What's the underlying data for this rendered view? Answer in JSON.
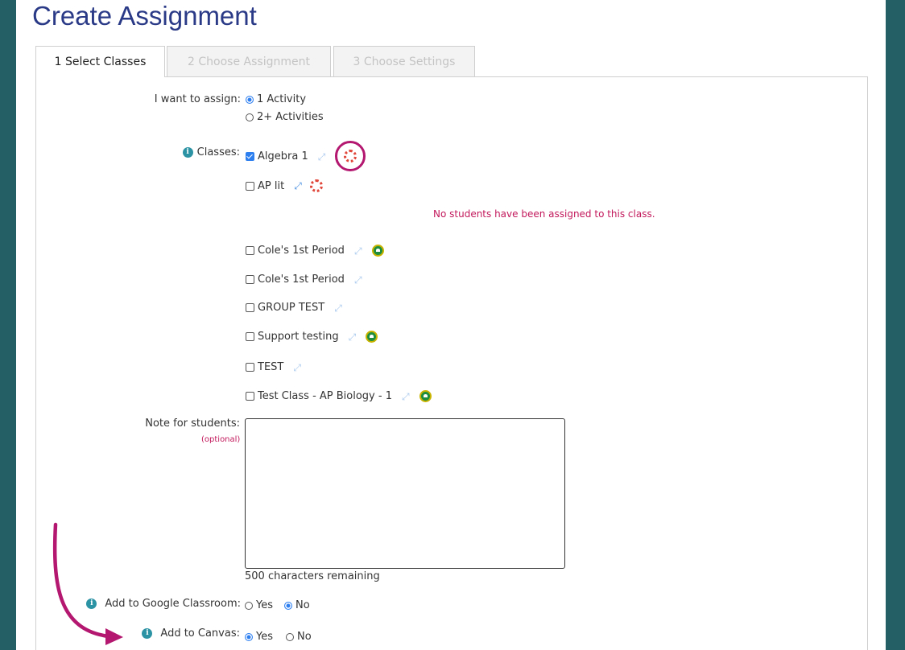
{
  "page": {
    "title": "Create Assignment"
  },
  "tabs": [
    {
      "label": "1 Select Classes",
      "active": true
    },
    {
      "label": "2 Choose Assignment",
      "active": false
    },
    {
      "label": "3 Choose Settings",
      "active": false
    }
  ],
  "assign": {
    "label": "I want to assign:",
    "options": [
      {
        "label": "1 Activity",
        "selected": true
      },
      {
        "label": "2+ Activities",
        "selected": false
      }
    ]
  },
  "classes": {
    "label": "Classes:",
    "warning": "No students have been assigned to this class.",
    "items": [
      {
        "name": "Algebra 1",
        "checked": true,
        "canvas": true,
        "google_classroom": false
      },
      {
        "name": "AP lit",
        "checked": false,
        "canvas": true,
        "google_classroom": false
      },
      {
        "name": "Cole's 1st Period",
        "checked": false,
        "canvas": false,
        "google_classroom": true
      },
      {
        "name": "Cole's 1st Period",
        "checked": false,
        "canvas": false,
        "google_classroom": false
      },
      {
        "name": "GROUP TEST",
        "checked": false,
        "canvas": false,
        "google_classroom": false
      },
      {
        "name": "Support testing",
        "checked": false,
        "canvas": false,
        "google_classroom": true
      },
      {
        "name": "TEST",
        "checked": false,
        "canvas": false,
        "google_classroom": false
      },
      {
        "name": "Test Class - AP Biology - 1",
        "checked": false,
        "canvas": false,
        "google_classroom": true
      }
    ]
  },
  "note": {
    "label": "Note for students:",
    "optional": "(optional)",
    "value": "",
    "counter": "500 characters remaining"
  },
  "google_classroom": {
    "label": "Add to Google Classroom:",
    "yes": "Yes",
    "no": "No",
    "selected": "No"
  },
  "canvas": {
    "label": "Add to Canvas:",
    "yes": "Yes",
    "no": "No",
    "selected": "Yes"
  },
  "icons": {
    "info": "info-icon",
    "expand": "expand-arrows-icon",
    "canvas": "canvas-logo-icon",
    "google_classroom": "google-classroom-icon"
  },
  "colors": {
    "background": "#255f66",
    "title": "#2b3a86",
    "accent_blue": "#2d7ff0",
    "annotation_magenta": "#b3176f",
    "warning": "#c2185b"
  }
}
